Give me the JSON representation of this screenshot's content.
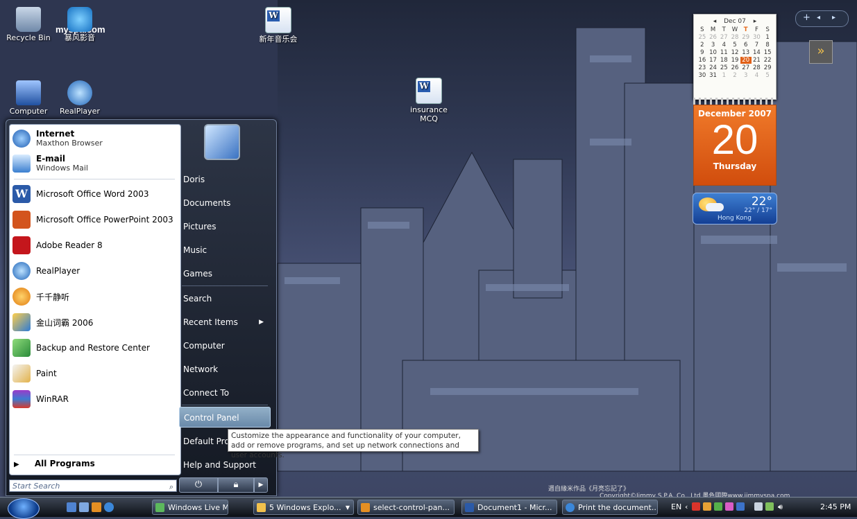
{
  "desktop": {
    "icons": [
      {
        "label": "Recycle Bin"
      },
      {
        "label": "暴风影音"
      },
      {
        "label": "新年音乐会"
      },
      {
        "label": "Computer"
      },
      {
        "label": "RealPlayer"
      },
      {
        "label": "insurance MCQ"
      }
    ],
    "logo_text": "myspa.com",
    "copyright_line1": "週自緣米作品《月亮忘記了》",
    "copyright_line2": "Copyright©Jimmy S.P.A. Co., Ltd 墨色國際www.jimmyspa.com"
  },
  "gadgets": {
    "bar_plus": "+",
    "calendar_mini": {
      "month": "Dec 07",
      "weekdays": [
        "S",
        "M",
        "T",
        "W",
        "T",
        "F",
        "S"
      ],
      "days": [
        "25",
        "26",
        "27",
        "28",
        "29",
        "30",
        "1",
        "2",
        "3",
        "4",
        "5",
        "6",
        "7",
        "8",
        "9",
        "10",
        "11",
        "12",
        "13",
        "14",
        "15",
        "16",
        "17",
        "18",
        "19",
        "20",
        "21",
        "22",
        "23",
        "24",
        "25",
        "26",
        "27",
        "28",
        "29",
        "30",
        "31",
        "1",
        "2",
        "3",
        "4",
        "5"
      ]
    },
    "calendar_big": {
      "month": "December 2007",
      "day": "20",
      "weekday": "Thursday"
    },
    "weather": {
      "temp": "22°",
      "range": "22° / 17°",
      "city": "Hong Kong"
    }
  },
  "start_menu": {
    "pinned": [
      {
        "title": "Internet",
        "subtitle": "Maxthon Browser"
      },
      {
        "title": "E-mail",
        "subtitle": "Windows Mail"
      }
    ],
    "recent": [
      "Microsoft Office Word 2003",
      "Microsoft Office PowerPoint 2003",
      "Adobe Reader 8",
      "RealPlayer",
      "千千静听",
      "金山词霸 2006",
      "Backup and Restore Center",
      "Paint",
      "WinRAR"
    ],
    "all_programs": "All Programs",
    "search_placeholder": "Start Search",
    "right_items": [
      "Doris",
      "Documents",
      "Pictures",
      "Music",
      "Games",
      "Search",
      "Recent Items",
      "Computer",
      "Network",
      "Connect To",
      "Control Panel",
      "Default Programs",
      "Help and Support"
    ],
    "tooltip": "Customize the appearance and functionality of your computer, add or remove programs, and set up network connections and user accounts."
  },
  "taskbar": {
    "buttons": [
      "Windows Live Mes...",
      "5 Windows Explo...",
      "select-control-pan...",
      "Document1 - Micr...",
      "Print the document..."
    ],
    "language": "EN",
    "clock": "2:45 PM"
  }
}
